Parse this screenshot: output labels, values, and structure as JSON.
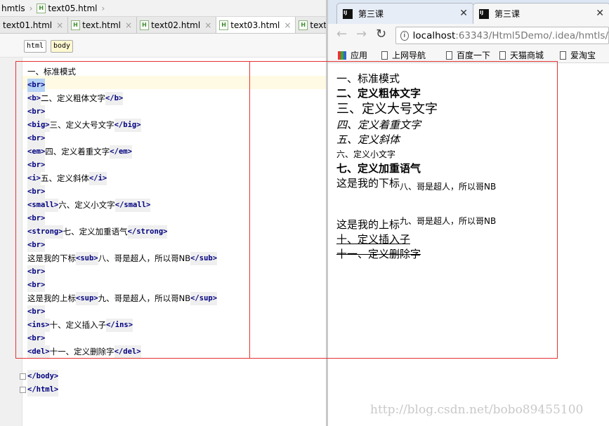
{
  "ide": {
    "breadcrumb": [
      "hmtls",
      "text05.html"
    ],
    "tabs": [
      {
        "label": "text01.html",
        "active": false
      },
      {
        "label": "text.html",
        "active": false
      },
      {
        "label": "text02.html",
        "active": false
      },
      {
        "label": "text03.html",
        "active": true
      },
      {
        "label": "text",
        "active": false
      }
    ],
    "tagbar": [
      "html",
      "body"
    ],
    "code_lines": [
      {
        "pre": "",
        "open": "",
        "text": "一、标准模式",
        "close": ""
      },
      {
        "pre": "",
        "open": "<br>",
        "text": "",
        "close": ""
      },
      {
        "pre": "",
        "open": "<b>",
        "text": "二、定义粗体文字",
        "close": "</b>"
      },
      {
        "pre": "",
        "open": "<br>",
        "text": "",
        "close": ""
      },
      {
        "pre": "",
        "open": "<big>",
        "text": "三、定义大号文字",
        "close": "</big>"
      },
      {
        "pre": "",
        "open": "<br>",
        "text": "",
        "close": ""
      },
      {
        "pre": "",
        "open": "<em>",
        "text": "四、定义着重文字",
        "close": "</em>"
      },
      {
        "pre": "",
        "open": "<br>",
        "text": "",
        "close": ""
      },
      {
        "pre": "",
        "open": "<i>",
        "text": "五、定义斜体",
        "close": "</i>"
      },
      {
        "pre": "",
        "open": "<br>",
        "text": "",
        "close": ""
      },
      {
        "pre": "",
        "open": "<small>",
        "text": "六、定义小文字",
        "close": "</small>"
      },
      {
        "pre": "",
        "open": "<br>",
        "text": "",
        "close": ""
      },
      {
        "pre": "",
        "open": "<strong>",
        "text": "七、定义加重语气",
        "close": "</strong>"
      },
      {
        "pre": "",
        "open": "<br>",
        "text": "",
        "close": ""
      },
      {
        "pre": "这是我的下标",
        "open": "<sub>",
        "text": "八、哥是超人，所以哥NB",
        "close": "</sub>"
      },
      {
        "pre": "",
        "open": "<br>",
        "text": "",
        "close": ""
      },
      {
        "pre": "",
        "open": "<br>",
        "text": "",
        "close": ""
      },
      {
        "pre": "这是我的上标",
        "open": "<sup>",
        "text": "九、哥是超人，所以哥NB",
        "close": "</sup>"
      },
      {
        "pre": "",
        "open": "<br>",
        "text": "",
        "close": ""
      },
      {
        "pre": "",
        "open": "<ins>",
        "text": "十、定义插入子",
        "close": "</ins>"
      },
      {
        "pre": "",
        "open": "<br>",
        "text": "",
        "close": ""
      },
      {
        "pre": "",
        "open": "<del>",
        "text": "十一、定义删除字",
        "close": "</del>"
      }
    ],
    "tail": [
      "</body>",
      "</html>"
    ]
  },
  "browser": {
    "tabs": [
      "第三课",
      "第三课"
    ],
    "url_host": "localhost",
    "url_rest": ":63343/Html5Demo/.idea/hmtls/",
    "bookmarks": [
      "应用",
      "上网导航",
      "百度一下",
      "天猫商城",
      "爱淘宝"
    ],
    "page": {
      "l1": "一、标准模式",
      "l2": "二、定义粗体文字",
      "l3": "三、定义大号文字",
      "l4": "四、定义着重文字",
      "l5": "五、定义斜体",
      "l6": "六、定义小文字",
      "l7": "七、定义加重语气",
      "l8_pre": "这是我的下标",
      "l8_sub": "八、哥是超人，所以哥NB",
      "l9_pre": "这是我的上标",
      "l9_sup": "九、哥是超人，所以哥NB",
      "l10": "十、定义插入子",
      "l11": "十一、定义删除字"
    }
  },
  "watermark": "http://blog.csdn.net/bobo89455100"
}
